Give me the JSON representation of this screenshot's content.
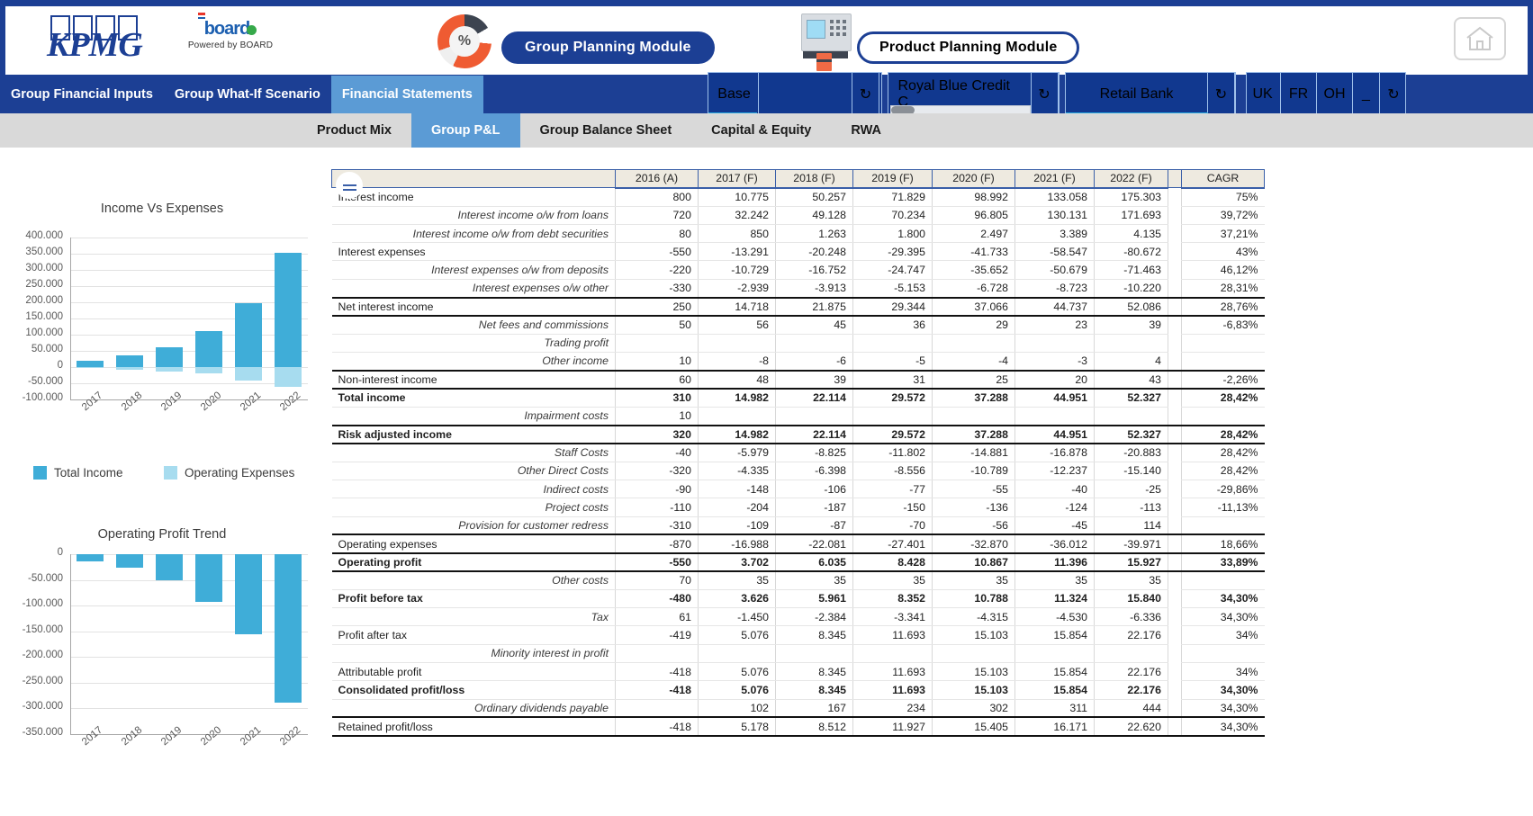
{
  "header": {
    "kpmg_logo": "KPMG",
    "board_logo": "board",
    "board_tagline": "Powered by BOARD",
    "donut_label": "%",
    "group_module_button": "Group Planning Module",
    "product_module_button": "Product  Planning Module",
    "home_icon": "home-icon"
  },
  "nav": {
    "items": [
      {
        "label": "Group Financial Inputs",
        "active": false
      },
      {
        "label": "Group What-If Scenario",
        "active": false
      },
      {
        "label": "Financial Statements",
        "active": true
      }
    ]
  },
  "selectors": [
    {
      "label": "Base",
      "value": "",
      "refresh": "↻",
      "scrollbar": false
    },
    {
      "label": "",
      "value": "Royal Blue Credit C",
      "refresh": "↻",
      "scrollbar": true
    },
    {
      "label": "",
      "value": "Retail Bank",
      "refresh": "↻",
      "scrollbar": false
    }
  ],
  "regions": {
    "items": [
      "UK",
      "FR",
      "OH",
      "_"
    ],
    "refresh": "↻"
  },
  "subnav": {
    "items": [
      {
        "label": "Product Mix",
        "active": false
      },
      {
        "label": "Group P&L",
        "active": true
      },
      {
        "label": "Group Balance Sheet",
        "active": false
      },
      {
        "label": "Capital & Equity",
        "active": false
      },
      {
        "label": "RWA",
        "active": false
      }
    ]
  },
  "chart_data": [
    {
      "type": "bar",
      "title": "Income Vs Expenses",
      "categories": [
        "2017",
        "2018",
        "2019",
        "2020",
        "2021",
        "2022"
      ],
      "series": [
        {
          "name": "Total Income",
          "values": [
            20000,
            35000,
            62000,
            110000,
            198000,
            353000
          ]
        },
        {
          "name": "Operating Expenses",
          "values": [
            -1000,
            -7000,
            -13000,
            -19000,
            -42000,
            -60000
          ]
        }
      ],
      "ylim": [
        -100000,
        400000
      ],
      "yticks": [
        "400.000",
        "350.000",
        "300.000",
        "250.000",
        "200.000",
        "150.000",
        "100.000",
        "50.000",
        "0",
        "-50.000",
        "-100.000"
      ],
      "xlabel": "",
      "ylabel": "",
      "grid": true,
      "legend": "bottom",
      "colors": {
        "Total Income": "#3fadd8",
        "Operating Expenses": "#a7dcef"
      }
    },
    {
      "type": "bar",
      "title": "Operating Profit Trend",
      "categories": [
        "2017",
        "2018",
        "2019",
        "2020",
        "2021",
        "2022"
      ],
      "values": [
        -14000,
        -27000,
        -51000,
        -92000,
        -155000,
        -288000
      ],
      "ylim": [
        -350000,
        0
      ],
      "yticks": [
        "0",
        "-50.000",
        "-100.000",
        "-150.000",
        "-200.000",
        "-250.000",
        "-300.000",
        "-350.000"
      ],
      "xlabel": "",
      "ylabel": "",
      "grid": true,
      "color": "#3fadd8"
    }
  ],
  "table": {
    "menu_icon": "hamburger-icon",
    "columns": [
      "",
      "2016 (A)",
      "2017 (F)",
      "2018 (F)",
      "2019 (F)",
      "2020 (F)",
      "2021 (F)",
      "2022 (F)",
      "",
      "CAGR"
    ],
    "rows": [
      {
        "label": "Interest income",
        "indent": false,
        "bold": false,
        "values": [
          "800",
          "10.775",
          "50.257",
          "71.829",
          "98.992",
          "133.058",
          "175.303"
        ],
        "cagr": "75%"
      },
      {
        "label": "Interest income o/w from loans",
        "indent": true,
        "bold": false,
        "values": [
          "720",
          "32.242",
          "49.128",
          "70.234",
          "96.805",
          "130.131",
          "171.693"
        ],
        "cagr": "39,72%"
      },
      {
        "label": "Interest income o/w from debt securities",
        "indent": true,
        "bold": false,
        "values": [
          "80",
          "850",
          "1.263",
          "1.800",
          "2.497",
          "3.389",
          "4.135"
        ],
        "cagr": "37,21%"
      },
      {
        "label": "Interest expenses",
        "indent": false,
        "bold": false,
        "values": [
          "-550",
          "-13.291",
          "-20.248",
          "-29.395",
          "-41.733",
          "-58.547",
          "-80.672"
        ],
        "cagr": "43%"
      },
      {
        "label": "Interest expenses o/w from deposits",
        "indent": true,
        "bold": false,
        "values": [
          "-220",
          "-10.729",
          "-16.752",
          "-24.747",
          "-35.652",
          "-50.679",
          "-71.463"
        ],
        "cagr": "46,12%"
      },
      {
        "label": "Interest expenses o/w other",
        "indent": true,
        "bold": false,
        "values": [
          "-330",
          "-2.939",
          "-3.913",
          "-5.153",
          "-6.728",
          "-8.723",
          "-10.220"
        ],
        "cagr": "28,31%",
        "botline": true
      },
      {
        "label": "Net interest income",
        "indent": false,
        "bold": false,
        "values": [
          "250",
          "14.718",
          "21.875",
          "29.344",
          "37.066",
          "44.737",
          "52.086"
        ],
        "cagr": "28,76%",
        "botline": true
      },
      {
        "label": "Net fees and commissions",
        "indent": true,
        "bold": false,
        "values": [
          "50",
          "56",
          "45",
          "36",
          "29",
          "23",
          "39"
        ],
        "cagr": "-6,83%"
      },
      {
        "label": "Trading profit",
        "indent": true,
        "bold": false,
        "values": [
          "",
          "",
          "",
          "",
          "",
          "",
          ""
        ],
        "cagr": ""
      },
      {
        "label": "Other income",
        "indent": true,
        "bold": false,
        "values": [
          "10",
          "-8",
          "-6",
          "-5",
          "-4",
          "-3",
          "4"
        ],
        "cagr": "",
        "botline": true
      },
      {
        "label": "Non-interest income",
        "indent": false,
        "bold": false,
        "values": [
          "60",
          "48",
          "39",
          "31",
          "25",
          "20",
          "43"
        ],
        "cagr": "-2,26%",
        "botline": true
      },
      {
        "label": "Total income",
        "indent": false,
        "bold": true,
        "values": [
          "310",
          "14.982",
          "22.114",
          "29.572",
          "37.288",
          "44.951",
          "52.327"
        ],
        "cagr": "28,42%"
      },
      {
        "label": "Impairment costs",
        "indent": true,
        "bold": false,
        "values": [
          "10",
          "",
          "",
          "",
          "",
          "",
          ""
        ],
        "cagr": "",
        "botline": true
      },
      {
        "label": "Risk adjusted income",
        "indent": false,
        "bold": true,
        "values": [
          "320",
          "14.982",
          "22.114",
          "29.572",
          "37.288",
          "44.951",
          "52.327"
        ],
        "cagr": "28,42%",
        "botline": true
      },
      {
        "label": "Staff Costs",
        "indent": true,
        "bold": false,
        "values": [
          "-40",
          "-5.979",
          "-8.825",
          "-11.802",
          "-14.881",
          "-16.878",
          "-20.883"
        ],
        "cagr": "28,42%"
      },
      {
        "label": "Other Direct Costs",
        "indent": true,
        "bold": false,
        "values": [
          "-320",
          "-4.335",
          "-6.398",
          "-8.556",
          "-10.789",
          "-12.237",
          "-15.140"
        ],
        "cagr": "28,42%"
      },
      {
        "label": "Indirect costs",
        "indent": true,
        "bold": false,
        "values": [
          "-90",
          "-148",
          "-106",
          "-77",
          "-55",
          "-40",
          "-25"
        ],
        "cagr": "-29,86%"
      },
      {
        "label": "Project costs",
        "indent": true,
        "bold": false,
        "values": [
          "-110",
          "-204",
          "-187",
          "-150",
          "-136",
          "-124",
          "-113"
        ],
        "cagr": "-11,13%"
      },
      {
        "label": "Provision for customer redress",
        "indent": true,
        "bold": false,
        "values": [
          "-310",
          "-109",
          "-87",
          "-70",
          "-56",
          "-45",
          "114"
        ],
        "cagr": "",
        "botline": true
      },
      {
        "label": "Operating expenses",
        "indent": false,
        "bold": false,
        "values": [
          "-870",
          "-16.988",
          "-22.081",
          "-27.401",
          "-32.870",
          "-36.012",
          "-39.971"
        ],
        "cagr": "18,66%",
        "botline": true
      },
      {
        "label": "Operating profit",
        "indent": false,
        "bold": true,
        "values": [
          "-550",
          "3.702",
          "6.035",
          "8.428",
          "10.867",
          "11.396",
          "15.927"
        ],
        "cagr": "33,89%",
        "botline": true
      },
      {
        "label": "Other costs",
        "indent": true,
        "bold": false,
        "values": [
          "70",
          "35",
          "35",
          "35",
          "35",
          "35",
          "35"
        ],
        "cagr": ""
      },
      {
        "label": "Profit before tax",
        "indent": false,
        "bold": true,
        "values": [
          "-480",
          "3.626",
          "5.961",
          "8.352",
          "10.788",
          "11.324",
          "15.840"
        ],
        "cagr": "34,30%"
      },
      {
        "label": "Tax",
        "indent": true,
        "bold": false,
        "values": [
          "61",
          "-1.450",
          "-2.384",
          "-3.341",
          "-4.315",
          "-4.530",
          "-6.336"
        ],
        "cagr": "34,30%"
      },
      {
        "label": "Profit after tax",
        "indent": false,
        "bold": false,
        "values": [
          "-419",
          "5.076",
          "8.345",
          "11.693",
          "15.103",
          "15.854",
          "22.176"
        ],
        "cagr": "34%"
      },
      {
        "label": "Minority interest in profit",
        "indent": true,
        "bold": false,
        "values": [
          "",
          "",
          "",
          "",
          "",
          "",
          ""
        ],
        "cagr": ""
      },
      {
        "label": "Attributable profit",
        "indent": false,
        "bold": false,
        "values": [
          "-418",
          "5.076",
          "8.345",
          "11.693",
          "15.103",
          "15.854",
          "22.176"
        ],
        "cagr": "34%"
      },
      {
        "label": "Consolidated profit/loss",
        "indent": false,
        "bold": true,
        "values": [
          "-418",
          "5.076",
          "8.345",
          "11.693",
          "15.103",
          "15.854",
          "22.176"
        ],
        "cagr": "34,30%"
      },
      {
        "label": "Ordinary dividends payable",
        "indent": true,
        "bold": false,
        "values": [
          "",
          "102",
          "167",
          "234",
          "302",
          "311",
          "444"
        ],
        "cagr": "34,30%",
        "botline": true
      },
      {
        "label": "Retained profit/loss",
        "indent": false,
        "bold": false,
        "values": [
          "-418",
          "5.178",
          "8.512",
          "11.927",
          "15.405",
          "16.171",
          "22.620"
        ],
        "cagr": "34,30%",
        "botline": true
      }
    ]
  }
}
